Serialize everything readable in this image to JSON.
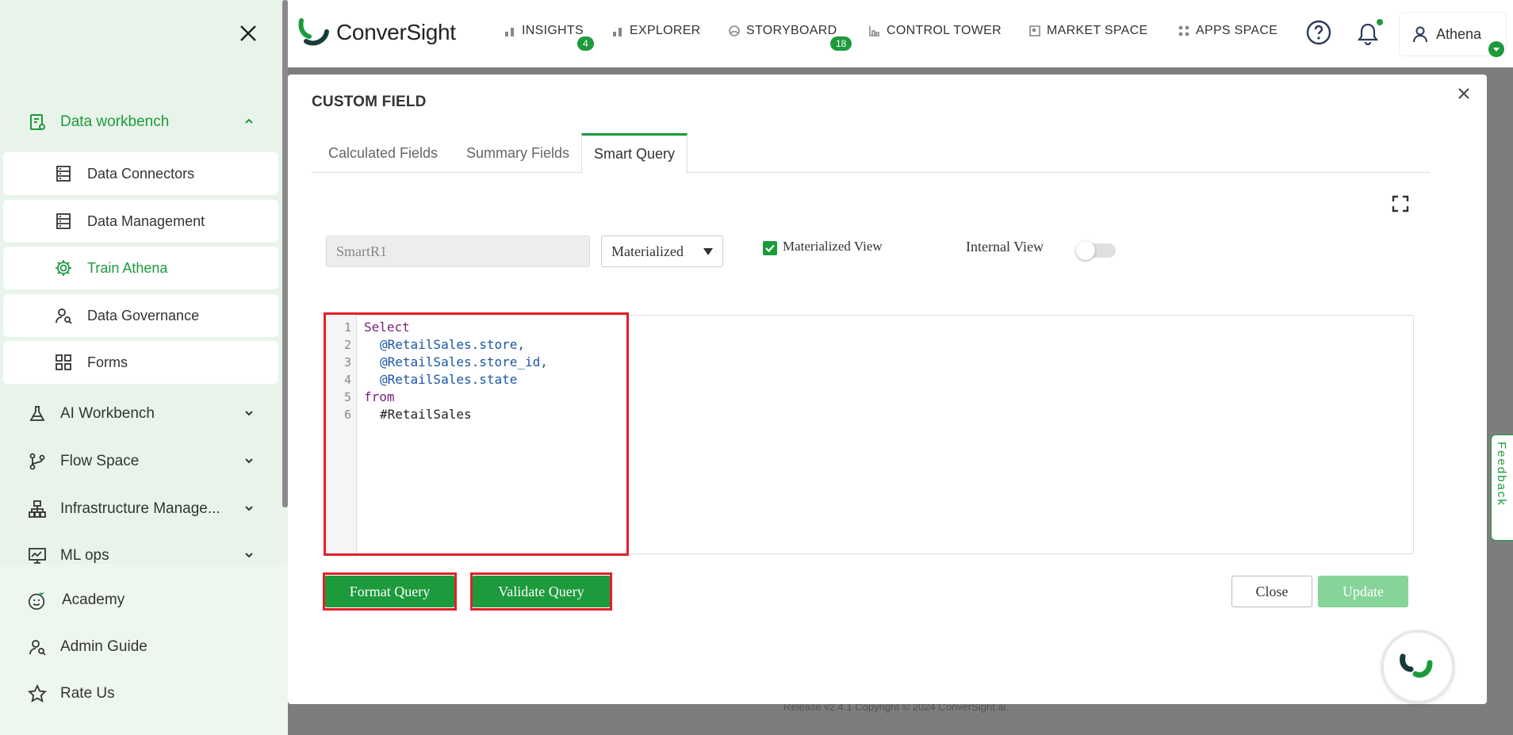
{
  "sidebar": {
    "groups": [
      {
        "label": "Data workbench",
        "icon": "document-chart-icon",
        "expanded": true
      },
      {
        "label": "AI Workbench",
        "icon": "flask-icon"
      },
      {
        "label": "Flow Space",
        "icon": "branch-icon"
      },
      {
        "label": "Infrastructure Manage...",
        "icon": "hierarchy-icon"
      },
      {
        "label": "ML ops",
        "icon": "monitor-chart-icon"
      }
    ],
    "sub_items": [
      {
        "label": "Data Connectors",
        "icon": "server-icon"
      },
      {
        "label": "Data Management",
        "icon": "server-icon"
      },
      {
        "label": "Train Athena",
        "icon": "gear-icon",
        "active": true
      },
      {
        "label": "Data Governance",
        "icon": "user-search-icon"
      },
      {
        "label": "Forms",
        "icon": "grid-icon"
      }
    ],
    "bottom_items": [
      {
        "label": "Academy",
        "icon": "academy-icon"
      },
      {
        "label": "Admin Guide",
        "icon": "user-guide-icon"
      },
      {
        "label": "Rate Us",
        "icon": "star-icon"
      }
    ]
  },
  "topnav": {
    "logo_text": "ConverSight",
    "items": [
      {
        "label": "INSIGHTS",
        "badge": "4"
      },
      {
        "label": "EXPLORER"
      },
      {
        "label": "STORYBOARD",
        "badge": "18"
      },
      {
        "label": "CONTROL TOWER"
      },
      {
        "label": "MARKET SPACE"
      },
      {
        "label": "APPS SPACE"
      }
    ],
    "user_name": "Athena"
  },
  "modal": {
    "title": "CUSTOM FIELD",
    "tabs": [
      {
        "label": "Calculated Fields"
      },
      {
        "label": "Summary Fields"
      },
      {
        "label": "Smart Query",
        "active": true
      }
    ],
    "name_value": "SmartR1",
    "select_value": "Materialized",
    "materialized_view_label": "Materialized View",
    "materialized_view_checked": true,
    "internal_view_label": "Internal View",
    "internal_view_on": false,
    "code_lines": [
      {
        "num": "1",
        "text": "Select"
      },
      {
        "num": "2",
        "text": "@RetailSales.store,"
      },
      {
        "num": "3",
        "text": "@RetailSales.store_id,"
      },
      {
        "num": "4",
        "text": "@RetailSales.state"
      },
      {
        "num": "5",
        "text": "from"
      },
      {
        "num": "6",
        "text": "#RetailSales"
      }
    ],
    "buttons": {
      "format": "Format Query",
      "validate": "Validate Query",
      "close": "Close",
      "update": "Update"
    }
  },
  "footer_text": "Release v2.4.1 Copyright © 2024 ConverSight.ai.",
  "feedback_label": "Feedback",
  "colors": {
    "accent": "#1d9a3c",
    "highlight": "#e0202a",
    "sidebar_bg": "#e8f4ea"
  }
}
